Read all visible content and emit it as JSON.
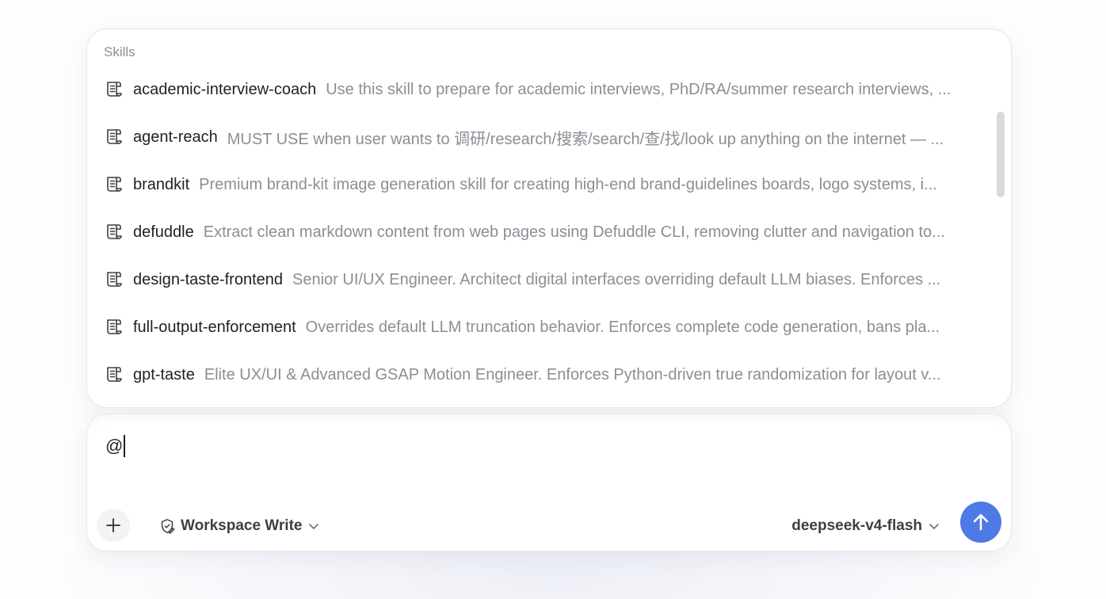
{
  "skills_panel": {
    "heading": "Skills",
    "items": [
      {
        "name": "academic-interview-coach",
        "description": "Use this skill to prepare for academic interviews, PhD/RA/summer research interviews, ..."
      },
      {
        "name": "agent-reach",
        "description": "MUST USE when user wants to 调研/research/搜索/search/查/找/look up anything on the internet — ..."
      },
      {
        "name": "brandkit",
        "description": "Premium brand-kit image generation skill for creating high-end brand-guidelines boards, logo systems, i..."
      },
      {
        "name": "defuddle",
        "description": "Extract clean markdown content from web pages using Defuddle CLI, removing clutter and navigation to..."
      },
      {
        "name": "design-taste-frontend",
        "description": "Senior UI/UX Engineer. Architect digital interfaces overriding default LLM biases. Enforces ..."
      },
      {
        "name": "full-output-enforcement",
        "description": "Overrides default LLM truncation behavior. Enforces complete code generation, bans pla..."
      },
      {
        "name": "gpt-taste",
        "description": "Elite UX/UI & Advanced GSAP Motion Engineer. Enforces Python-driven true randomization for layout v..."
      }
    ],
    "icon": "scroll-icon"
  },
  "composer": {
    "input_value": "@",
    "mode_label": "Workspace Write",
    "mode_icon": "shield-edit-icon",
    "model_label": "deepseek-v4-flash",
    "add_icon": "plus-icon",
    "send_icon": "arrow-up-icon"
  },
  "colors": {
    "send_button": "#4f79e6",
    "primary_text": "#1f2024",
    "secondary_text": "#8b8e95",
    "control_text": "#3c3f45"
  }
}
